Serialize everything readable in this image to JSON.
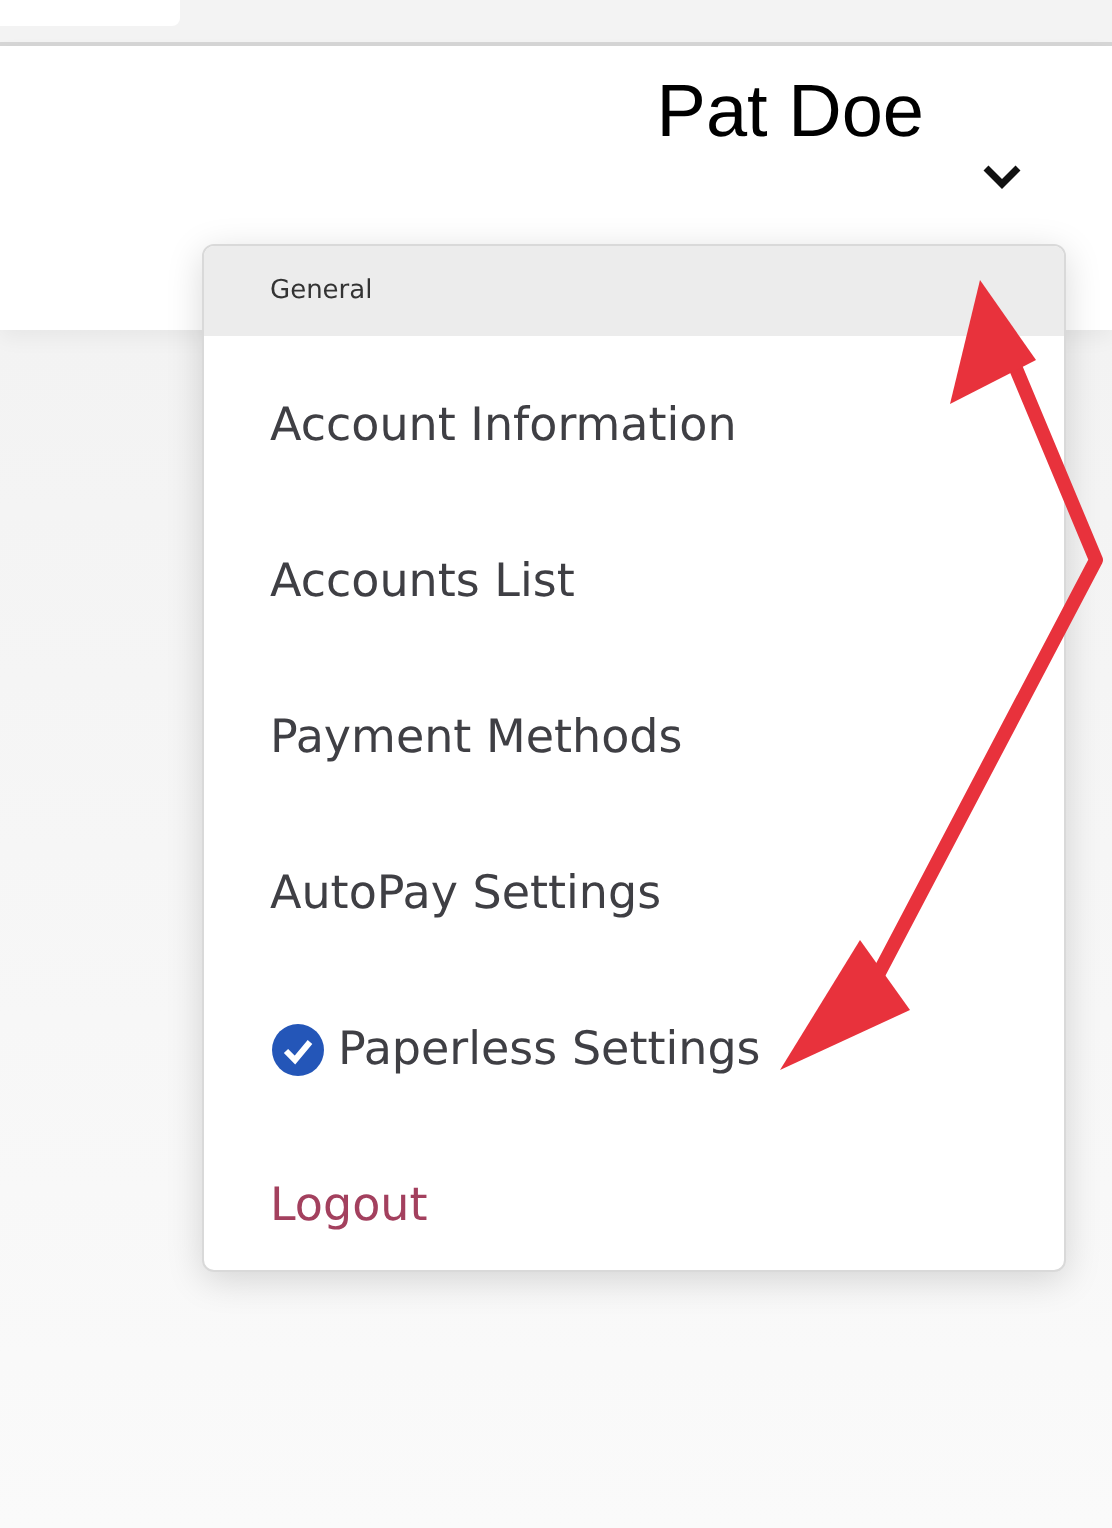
{
  "header": {
    "user_name": "Pat Doe"
  },
  "menu": {
    "section_title": "General",
    "items": [
      {
        "label": "Account Information",
        "kind": "link",
        "checked": false
      },
      {
        "label": "Accounts List",
        "kind": "link",
        "checked": false
      },
      {
        "label": "Payment Methods",
        "kind": "link",
        "checked": false
      },
      {
        "label": "AutoPay Settings",
        "kind": "link",
        "checked": false
      },
      {
        "label": "Paperless Settings",
        "kind": "link",
        "checked": true
      },
      {
        "label": "Logout",
        "kind": "logout",
        "checked": false
      }
    ]
  }
}
